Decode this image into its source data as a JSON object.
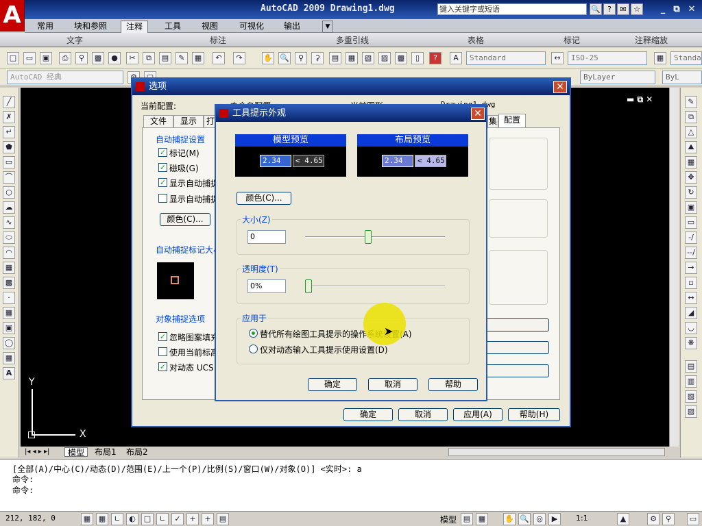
{
  "app": {
    "logo": "A",
    "title": "AutoCAD 2009   Drawing1.dwg",
    "search_placeholder": "键入关键字或短语"
  },
  "ribbon": {
    "tabs": [
      "常用",
      "块和参照",
      "注释",
      "工具",
      "视图",
      "可视化",
      "输出"
    ],
    "active_tab": "注释",
    "panels": [
      "文字",
      "标注",
      "多重引线",
      "表格",
      "标记",
      "注释缩放"
    ]
  },
  "toolbar": {
    "text_style": "Standard",
    "dim_style": "ISO-25",
    "table_style": "Standar",
    "workspace": "AutoCAD 经典",
    "bylayer": "ByLayer",
    "bylayer2": "ByL"
  },
  "drawing": {
    "ucs_y": "Y",
    "ucs_x": "X"
  },
  "layout_tabs": [
    "模型",
    "布局1",
    "布局2"
  ],
  "command": {
    "line1": "[全部(A)/中心(C)/动态(D)/范围(E)/上一个(P)/比例(S)/窗口(W)/对象(O)] <实时>: a",
    "line2": "命令:",
    "line3": "命令:"
  },
  "status": {
    "coords": "212, 182, 0",
    "model_label": "模型",
    "scale": "1:1"
  },
  "options_dialog": {
    "title": "选项",
    "current_config_label": "当前配置:",
    "current_config_value": "<<未命名配置>>",
    "current_drawing_label": "当前图形:",
    "current_drawing_value": "Drawing1.dwg",
    "tabs": [
      "文件",
      "显示",
      "打",
      "集",
      "配置"
    ],
    "autosnap_group": "自动捕捉设置",
    "chk_marker": "标记(M)",
    "chk_magnet": "磁吸(G)",
    "chk_show_tooltip": "显示自动捕捉",
    "chk_show_aperture": "显示自动捕捉",
    "color_button": "颜色(C)...",
    "marker_size_group": "自动捕捉标记大小",
    "osnap_group": "对象捕捉选项",
    "chk_ignore_hatch": "忽略图案填充",
    "chk_use_elev": "使用当前标高",
    "chk_dyn_ucs": "对动态 UCS",
    "ok": "确定",
    "cancel": "取消",
    "apply": "应用(A)",
    "help": "帮助(H)"
  },
  "tooltip_dialog": {
    "title": "工具提示外观",
    "model_preview": "模型预览",
    "layout_preview": "布局预览",
    "preview_value": "2.34",
    "preview_angle": "< 4.65",
    "color_button": "颜色(C)...",
    "size_group": "大小(Z)",
    "size_value": "0",
    "size_slider": 0.45,
    "transparency_group": "透明度(T)",
    "transparency_value": "0%",
    "transparency_slider": 0.0,
    "apply_group": "应用于",
    "radio_override": "替代所有绘图工具提示的操作系统设置(A)",
    "radio_dynamic": "仅对动态输入工具提示使用设置(D)",
    "ok": "确定",
    "cancel": "取消",
    "help": "帮助"
  }
}
